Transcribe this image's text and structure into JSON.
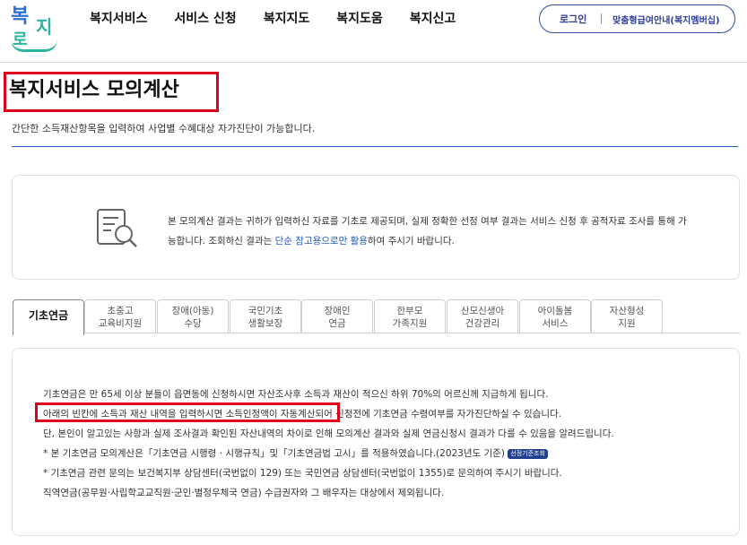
{
  "logo": {
    "text_1": "복",
    "text_2": "지",
    "text_3": "로"
  },
  "nav": [
    "복지서비스",
    "서비스 신청",
    "복지지도",
    "복지도움",
    "복지신고"
  ],
  "auth": {
    "login": "로그인",
    "guide": "맞춤형급여안내(복지멤버십)"
  },
  "page": {
    "title": "복지서비스 모의계산",
    "subtitle": "간단한 소득재산항목을 입력하여 사업별 수혜대상 자가진단이 가능합니다."
  },
  "notice": {
    "icon": "document-search-icon",
    "text_1": "본 모의계산 결과는 귀하가 입력하신 자료를 기초로 제공되며, 실제 정확한 선정 여부 결과는 서비스 신청 후 공적자료 조사를 통해 가",
    "text_2_before": "능합니다. 조회하신 결과는 ",
    "text_2_highlight": "단순 참고용으로만 활용",
    "text_2_after": "하여 주시기 바랍니다."
  },
  "tabs": [
    {
      "line1": "기초연금",
      "line2": "",
      "active": true
    },
    {
      "line1": "초중고",
      "line2": "교육비지원",
      "active": false
    },
    {
      "line1": "장애(아동)",
      "line2": "수당",
      "active": false
    },
    {
      "line1": "국민기초",
      "line2": "생활보장",
      "active": false
    },
    {
      "line1": "장애인",
      "line2": "연금",
      "active": false
    },
    {
      "line1": "한부모",
      "line2": "가족지원",
      "active": false
    },
    {
      "line1": "산모신생아",
      "line2": "건강관리",
      "active": false
    },
    {
      "line1": "아이돌봄",
      "line2": "서비스",
      "active": false
    },
    {
      "line1": "자산형성",
      "line2": "지원",
      "active": false
    }
  ],
  "content": {
    "line_1": "기초연금은 만 65세 이상 분들이 읍면동에 신청하시면 자산조사후 소득과 재산이 적으신 하위 70%의 어르신께 지급하게 됩니다.",
    "line_2": "아래의 빈칸에 소득과 재산 내역을 입력하시면 소득인정액이 자동계산되어 신청전에 기초연금 수령여부를 자가진단하실 수 있습니다.",
    "line_3": "단, 본인이 알고있는 사항과 실제 조사결과 확인된 자산내역의 차이로 인해 모의계산 결과와 실제 연금신청시 결과가 다를 수 있음을 알려드립니다.",
    "line_4": "* 본 기초연금 모의계산은「기초연금 시행령 · 시행규칙」및「기초연금법 고시」를 적용하였습니다.(2023년도 기준)",
    "badge": "선정기준조회",
    "line_5": "* 기초연금 관련 문의는 보건복지부 상담센터(국번없이 129) 또는 국민연금 상담센터(국번없이 1355)로 문의하여 주시기 바랍니다.",
    "line_6": "직역연금(공무원·사립학교교직원·군인·별정우체국 연금) 수급권자와 그 배우자는 대상에서 제외됩니다."
  },
  "colors": {
    "brand_blue": "#2b6fd6",
    "brand_teal": "#2bb4a0",
    "highlight_red": "#e0001b",
    "link_blue": "#2457c5"
  }
}
